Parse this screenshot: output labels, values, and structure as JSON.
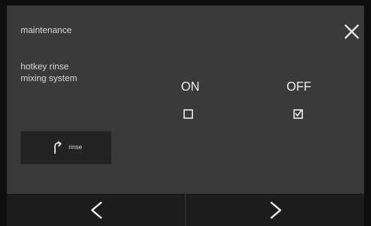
{
  "header": {
    "title": "maintenance",
    "close_icon": "close-icon"
  },
  "setting": {
    "label": "hotkey rinse\nmixing system"
  },
  "options": {
    "on": {
      "label": "ON",
      "checked": false
    },
    "off": {
      "label": "OFF",
      "checked": true
    }
  },
  "rinse_button": {
    "label": "rinse",
    "icon": "rinse-arrow-icon"
  },
  "nav": {
    "prev_icon": "chevron-left-icon",
    "next_icon": "chevron-right-icon"
  }
}
